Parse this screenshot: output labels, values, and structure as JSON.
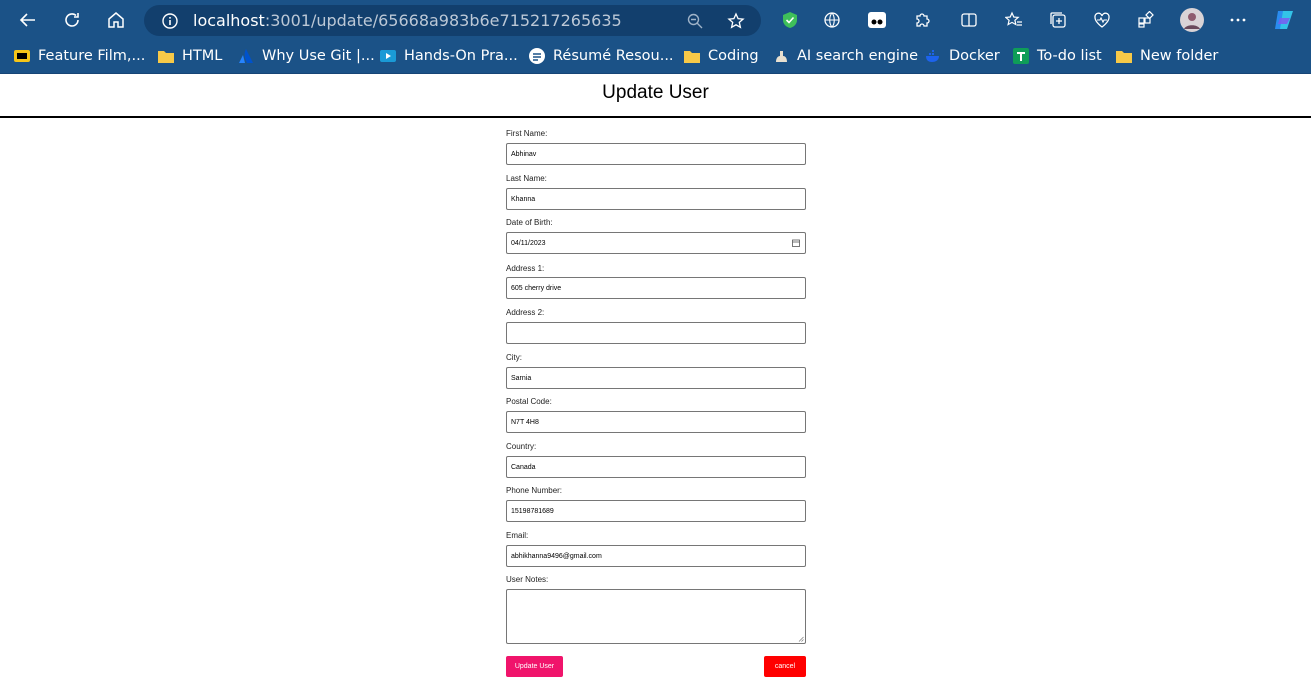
{
  "browser": {
    "url_host": "localhost",
    "url_rest": ":3001/update/65668a983b6e715217265635",
    "bookmarks": [
      {
        "label": "Feature Film,...",
        "icon": "imdb-icon"
      },
      {
        "label": "HTML",
        "icon": "folder-icon"
      },
      {
        "label": "Why Use Git |...",
        "icon": "atlassian-icon"
      },
      {
        "label": "Hands-On Pra...",
        "icon": "video-icon"
      },
      {
        "label": "Résumé Resou...",
        "icon": "resume-icon"
      },
      {
        "label": "Coding",
        "icon": "folder-icon"
      },
      {
        "label": "AI search engine",
        "icon": "ai-icon"
      },
      {
        "label": "Docker",
        "icon": "docker-icon"
      },
      {
        "label": "To-do list",
        "icon": "sheets-icon"
      },
      {
        "label": "New folder",
        "icon": "folder-icon"
      }
    ],
    "colors": {
      "chrome": "#1b5287",
      "urlbar": "#123f6d"
    }
  },
  "page": {
    "title": "Update User"
  },
  "form": {
    "first_name": {
      "label": "First Name:",
      "value": "Abhinav"
    },
    "last_name": {
      "label": "Last Name:",
      "value": "Khanna"
    },
    "dob": {
      "label": "Date of Birth:",
      "value": "04/11/2023"
    },
    "address1": {
      "label": "Address 1:",
      "value": "605 cherry drive"
    },
    "address2": {
      "label": "Address 2:",
      "value": ""
    },
    "city": {
      "label": "City:",
      "value": "Sarnia"
    },
    "postal": {
      "label": "Postal Code:",
      "value": "N7T 4H8"
    },
    "country": {
      "label": "Country:",
      "value": "Canada"
    },
    "phone": {
      "label": "Phone Number:",
      "value": "15198781689"
    },
    "email": {
      "label": "Email:",
      "value": "abhikhanna9496@gmail.com"
    },
    "notes": {
      "label": "User Notes:",
      "value": ""
    },
    "update_label": "Update User",
    "cancel_label": "cancel",
    "colors": {
      "update": "#f0146b",
      "cancel": "#ff0000"
    }
  }
}
